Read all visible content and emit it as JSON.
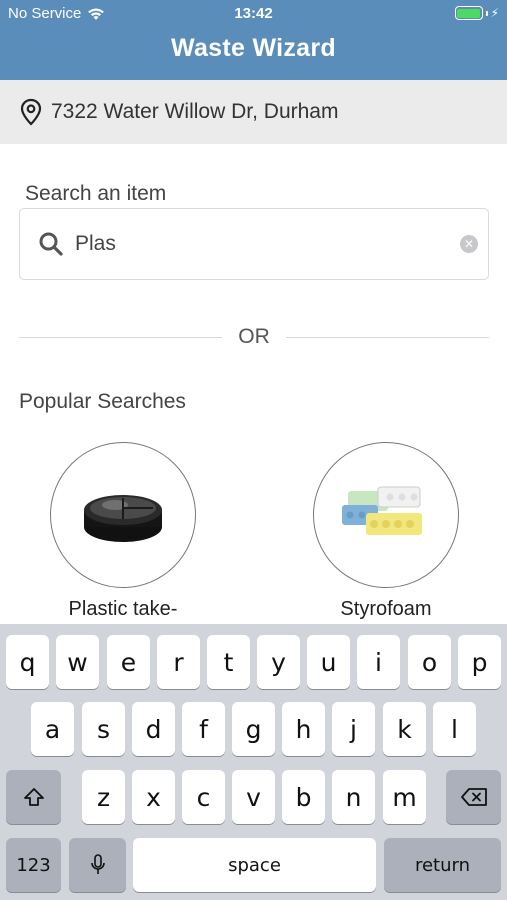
{
  "status_bar": {
    "carrier": "No Service",
    "time": "13:42"
  },
  "header": {
    "title": "Waste Wizard"
  },
  "location": {
    "address": "7322 Water Willow Dr, Durham"
  },
  "search": {
    "label": "Search an item",
    "value": "Plas"
  },
  "divider": {
    "text": "OR"
  },
  "popular": {
    "title": "Popular Searches",
    "items": [
      {
        "label": "Plastic take-",
        "icon": "plastic-container-image"
      },
      {
        "label": "Styrofoam",
        "icon": "styrofoam-egg-carton-image"
      }
    ]
  },
  "keyboard": {
    "row1": [
      "q",
      "w",
      "e",
      "r",
      "t",
      "y",
      "u",
      "i",
      "o",
      "p"
    ],
    "row2": [
      "a",
      "s",
      "d",
      "f",
      "g",
      "h",
      "j",
      "k",
      "l"
    ],
    "row3": [
      "z",
      "x",
      "c",
      "v",
      "b",
      "n",
      "m"
    ],
    "numbers_label": "123",
    "space_label": "space",
    "return_label": "return"
  },
  "colors": {
    "header_bg": "#5a8dba",
    "location_bg": "#ebebeb",
    "keyboard_bg": "#d1d5db",
    "battery": "#4cd964"
  }
}
